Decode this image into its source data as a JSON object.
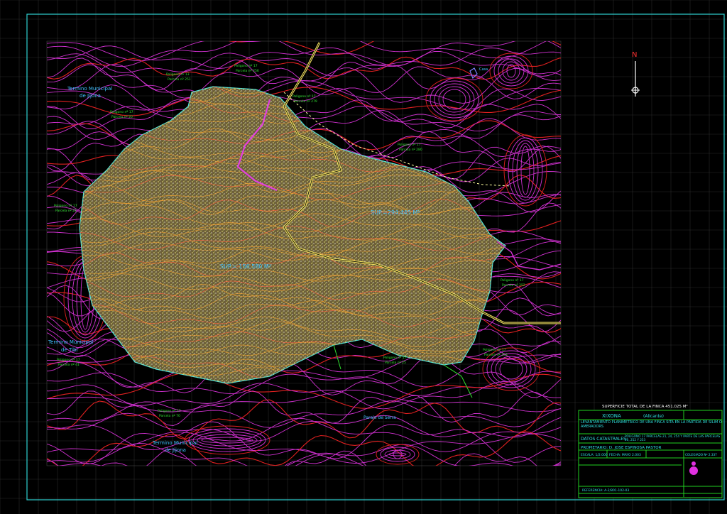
{
  "map": {
    "north_label": "N",
    "terminos": {
      "jijona_top": [
        "Termino Municipal",
        "de Jijona"
      ],
      "tibi": [
        "Termino Municipal",
        "de Tibi"
      ],
      "jijona_bottom": [
        "Termino Municipal",
        "de Jijona"
      ]
    },
    "sup_left": "SUP.= 156.580 M²",
    "sup_right": "SUP.=294.445 M²",
    "paraje": "Paraje de Serra",
    "casa": "Casa",
    "parcel_labels": [
      "Poligono nº 13",
      "Parcela nº 251",
      "Poligono nº 17",
      "Parcela nº 256",
      "Poligono nº 17",
      "Parcela nº 279",
      "Poligono nº 17",
      "Parcela nº 20",
      "Poligono nº 17",
      "Parcela nº 280",
      "Poligono nº 17",
      "Parcela nº 21",
      "Poligono nº 17",
      "Parcela nº 252",
      "Poligono nº 17",
      "Parcela nº 41",
      "Poligono nº 17",
      "Parcela nº 70",
      "Poligono nº 17",
      "Parcela nº 253",
      "Poligono nº 17",
      "Parcela nº 25"
    ]
  },
  "title_block": {
    "superficie": "SUPERFICIE TOTAL DE LA FINCA 451.025 M²",
    "town": "XIXONA",
    "province": "(Alicante)",
    "levantamiento": "LEVANTAMIENTO PLANIMETRICO DE UNA FINCA SITA EN LA PARTIDA DE SILIM O AMERADORS",
    "datos_label": "DATOS CATASTRALES:",
    "datos_value": "POLIGONO 17 PARCELAS 21, 24, 254 Y PARTE DE LAS PARCELAS 20, 252 Y 253",
    "propietario": "PROPIETARIO: D. JOSE ESPINOSA PASTOR",
    "escala": "ESCALA: 1/2.000",
    "fecha": "FECHA: MAYO 2.003",
    "colegiado": "COLEGIADO Nº 2.337",
    "bottom_ref": "REFERENCIA: A-2/801-102-03"
  },
  "colors": {
    "background": "#000000",
    "grid": "#2a2a2a",
    "frame": "#30d0d0",
    "contour_magenta": "#d030d0",
    "contour_red": "#e02020",
    "parcel_fill": "#7a6a40",
    "parcel_border": "#40e0e0",
    "road": "#f0e060",
    "title_block": "#20d020",
    "label_cyan": "#40c0ff",
    "label_green": "#30e030"
  }
}
